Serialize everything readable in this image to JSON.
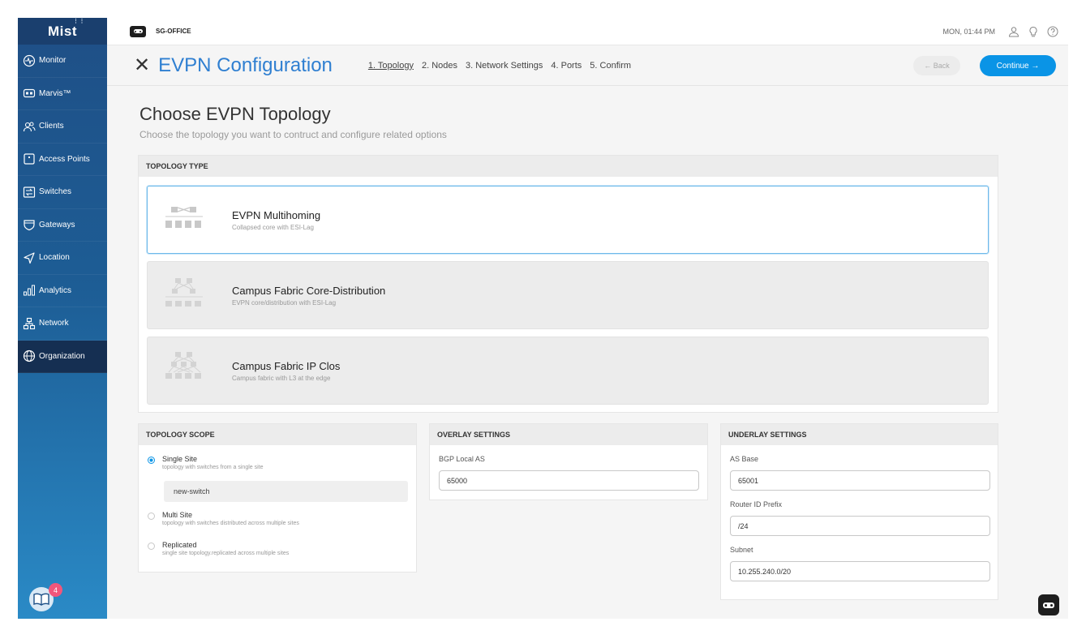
{
  "sidebar": {
    "logo": "Mist",
    "items": [
      {
        "label": "Monitor",
        "icon": "monitor-icon"
      },
      {
        "label": "Marvis™",
        "icon": "marvis-icon"
      },
      {
        "label": "Clients",
        "icon": "clients-icon"
      },
      {
        "label": "Access Points",
        "icon": "access-points-icon"
      },
      {
        "label": "Switches",
        "icon": "switches-icon"
      },
      {
        "label": "Gateways",
        "icon": "gateways-icon"
      },
      {
        "label": "Location",
        "icon": "location-icon"
      },
      {
        "label": "Analytics",
        "icon": "analytics-icon"
      },
      {
        "label": "Network",
        "icon": "network-icon"
      },
      {
        "label": "Organization",
        "icon": "organization-icon",
        "active": true
      }
    ],
    "help_badge_count": "4"
  },
  "header": {
    "org_name": "SG-OFFICE",
    "clock": "MON, 01:44 PM"
  },
  "wizard": {
    "title": "EVPN Configuration",
    "steps": [
      "1. Topology",
      "2. Nodes",
      "3. Network Settings",
      "4. Ports",
      "5. Confirm"
    ],
    "active_step": 0,
    "back_label": "← Back",
    "continue_label": "Continue →"
  },
  "section": {
    "heading": "Choose EVPN Topology",
    "subheading": "Choose the topology you want to contruct and configure related options"
  },
  "topology_type": {
    "header": "TOPOLOGY TYPE",
    "options": [
      {
        "title": "EVPN Multihoming",
        "desc": "Collapsed core with ESI-Lag",
        "selected": true
      },
      {
        "title": "Campus Fabric Core-Distribution",
        "desc": "EVPN core/distribution with ESI-Lag",
        "selected": false
      },
      {
        "title": "Campus Fabric IP Clos",
        "desc": "Campus fabric with L3 at the edge",
        "selected": false
      }
    ]
  },
  "topology_scope": {
    "header": "TOPOLOGY SCOPE",
    "options": [
      {
        "title": "Single Site",
        "desc": "topology with switches from a single site",
        "checked": true
      },
      {
        "title": "Multi Site",
        "desc": "topology with switches distributed across multiple sites",
        "checked": false
      },
      {
        "title": "Replicated",
        "desc": "single site topology.replicated across multiple sites",
        "checked": false
      }
    ],
    "site_value": "new-switch"
  },
  "overlay": {
    "header": "OVERLAY SETTINGS",
    "bgp_label": "BGP Local AS",
    "bgp_value": "65000"
  },
  "underlay": {
    "header": "UNDERLAY SETTINGS",
    "as_base_label": "AS Base",
    "as_base_value": "65001",
    "router_id_label": "Router ID Prefix",
    "router_id_value": "/24",
    "subnet_label": "Subnet",
    "subnet_value": "10.255.240.0/20"
  },
  "colors": {
    "accent": "#0a94e6",
    "title_blue": "#2f7fd1",
    "sidebar_dark": "#1a3f6e",
    "badge": "#f2567b"
  }
}
